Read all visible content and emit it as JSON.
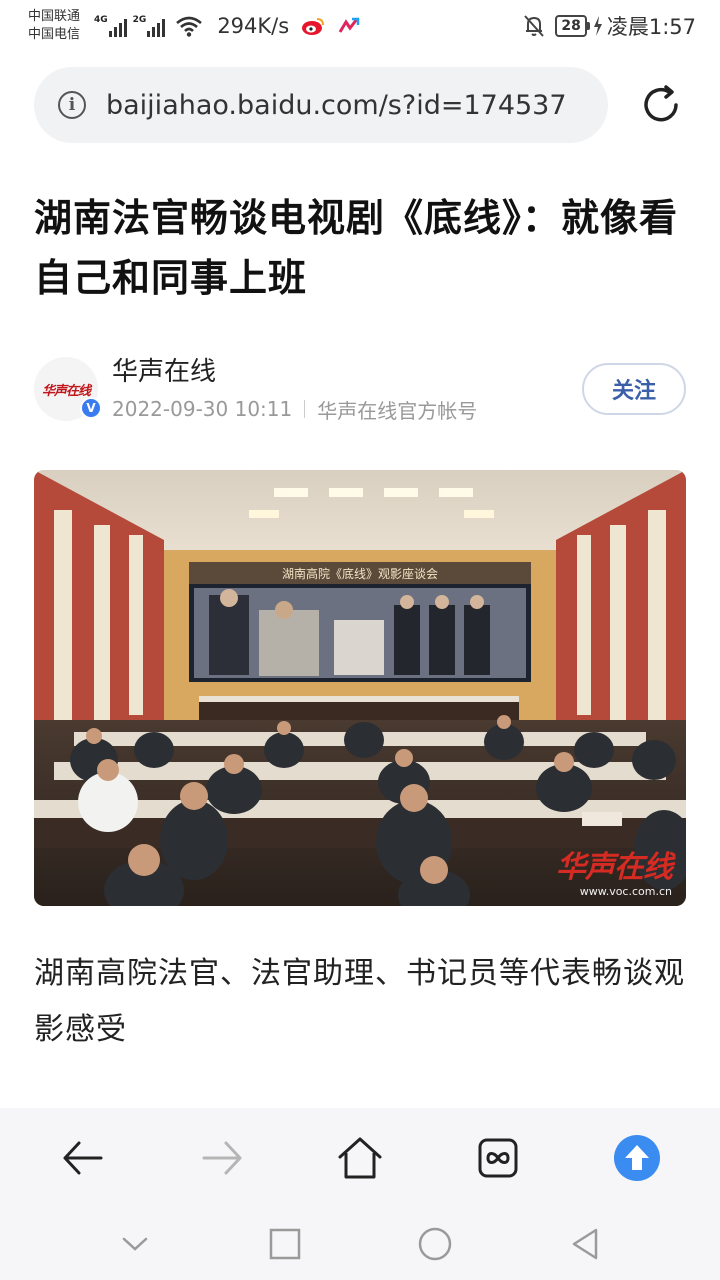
{
  "status_bar": {
    "carrier_1": "中国联通",
    "carrier_2": "中国电信",
    "sim1_tag": "4G",
    "sim2_tag": "2G",
    "net_speed": "294K/s",
    "battery": "28",
    "time": "凌晨1:57"
  },
  "browser": {
    "url": "baijiahao.baidu.com/s?id=174537",
    "icons": [
      "info-icon",
      "reload-icon"
    ]
  },
  "article": {
    "title": "湖南法官畅谈电视剧《底线》：就像看自己和同事上班",
    "author": {
      "name": "华声在线",
      "avatar_logo": "华声在线",
      "datetime": "2022-09-30 10:11",
      "account_type": "华声在线官方帐号",
      "follow_label": "关注"
    },
    "photo": {
      "banner_text": "湖南高院《底线》观影座谈会",
      "watermark": "华声在线",
      "watermark_url": "www.voc.com.cn"
    },
    "caption": "湖南高院法官、法官助理、书记员等代表畅谈观影感受"
  },
  "toolbar": {
    "items": [
      "back-arrow-icon",
      "forward-arrow-icon",
      "home-icon",
      "tabs-icon",
      "scroll-top-icon"
    ]
  },
  "system_nav": {
    "items": [
      "collapse-icon",
      "recents-icon",
      "home-circle-icon",
      "back-triangle-icon"
    ]
  },
  "colors": {
    "accent_blue": "#3a7cf0",
    "follow_text": "#3a5fa8",
    "watermark_red": "#d62b22"
  }
}
